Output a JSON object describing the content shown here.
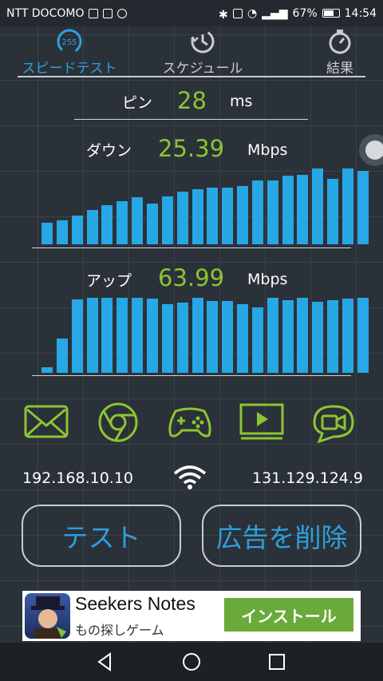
{
  "status": {
    "carrier": "NTT DOCOMO",
    "battery": "67%",
    "time": "14:54"
  },
  "tabs": {
    "speed": {
      "label": "スピードテスト",
      "badge": "255"
    },
    "schedule": {
      "label": "スケジュール"
    },
    "results": {
      "label": "結果"
    }
  },
  "ping": {
    "label": "ピン",
    "value": "28",
    "unit": "ms"
  },
  "download": {
    "label": "ダウン",
    "value": "25.39",
    "unit": "Mbps",
    "bars": [
      0.28,
      0.32,
      0.38,
      0.45,
      0.52,
      0.57,
      0.62,
      0.54,
      0.63,
      0.69,
      0.73,
      0.75,
      0.75,
      0.77,
      0.84,
      0.84,
      0.9,
      0.92,
      1.0,
      0.86,
      1.0,
      0.97
    ]
  },
  "upload": {
    "label": "アップ",
    "value": "63.99",
    "unit": "Mbps",
    "bars": [
      0.07,
      0.45,
      0.97,
      0.99,
      0.99,
      0.99,
      0.99,
      0.98,
      0.91,
      0.93,
      0.99,
      0.95,
      0.95,
      0.91,
      0.86,
      0.99,
      0.96,
      0.99,
      0.94,
      0.96,
      0.98,
      0.99
    ]
  },
  "icons": [
    "mail-icon",
    "chrome-icon",
    "gamepad-icon",
    "video-player-icon",
    "video-chat-icon"
  ],
  "network": {
    "local_ip": "192.168.10.10",
    "server_ip": "131.129.124.9"
  },
  "buttons": {
    "test": "テスト",
    "remove_ads": "広告を削除"
  },
  "ad": {
    "title": "Seekers Notes",
    "subtitle": "もの探しゲーム",
    "install": "インストール"
  },
  "colors": {
    "accent_blue": "#26a7e6",
    "accent_green": "#8bc534",
    "background": "#2b3138"
  }
}
